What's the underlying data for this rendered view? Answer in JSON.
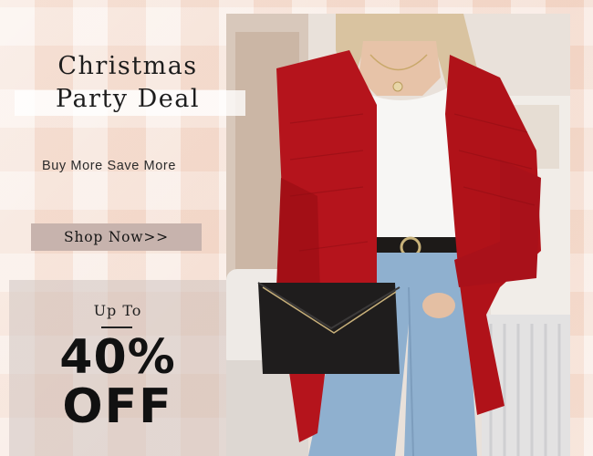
{
  "banner": {
    "headline_line1": "Christmas",
    "headline_line2": "Party Deal",
    "subheadline": "Buy More Save More",
    "cta_label": "Shop Now>>"
  },
  "promo": {
    "prefix": "Up To",
    "discount": "40%",
    "suffix": "OFF"
  },
  "colors": {
    "background": "#f7e6dc",
    "cardigan": "#b5141c",
    "button": "#c7b3ad",
    "text": "#111111"
  }
}
